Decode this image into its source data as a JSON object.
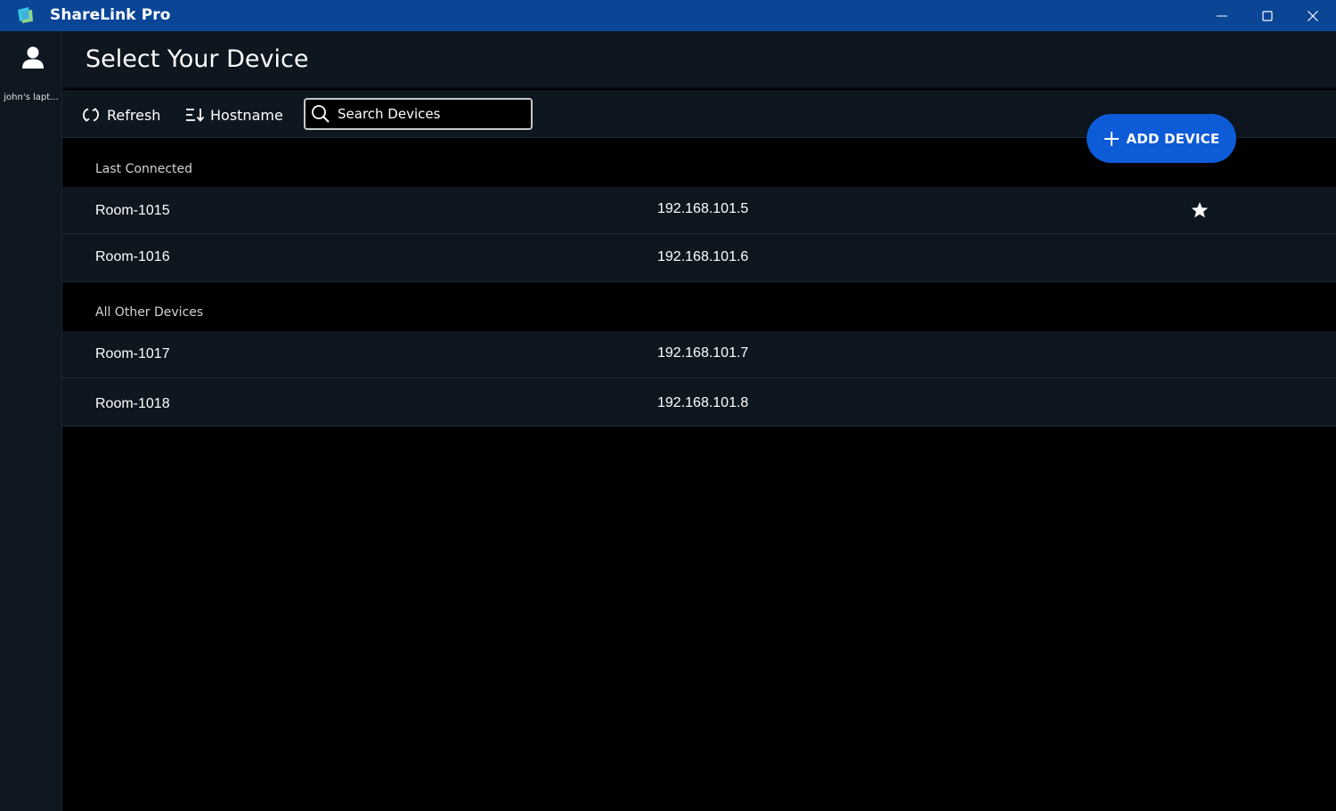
{
  "window": {
    "title": "ShareLink Pro",
    "logo_icon": "app-logo-icon",
    "controls": {
      "minimize_icon": "minimize-icon",
      "maximize_icon": "maximize-icon",
      "close_icon": "close-icon"
    },
    "titlebar_color": "#0a4596"
  },
  "sidebar": {
    "user": {
      "icon": "user-icon",
      "name": "john's lapt..."
    }
  },
  "header": {
    "title": "Select Your Device"
  },
  "toolbar": {
    "refresh": {
      "icon": "refresh-icon",
      "label": "Refresh"
    },
    "sort": {
      "icon": "sort-icon",
      "label": "Hostname"
    },
    "search": {
      "icon": "search-icon",
      "placeholder": "Search Devices",
      "value": ""
    }
  },
  "add_device": {
    "icon": "plus-icon",
    "label": "ADD DEVICE",
    "color": "#0d5bd6"
  },
  "sections": [
    {
      "label": "Last Connected",
      "devices": [
        {
          "name": "Room-1015",
          "ip": "192.168.101.5",
          "favorite": true
        },
        {
          "name": "Room-1016",
          "ip": "192.168.101.6",
          "favorite": false
        }
      ]
    },
    {
      "label": "All Other Devices",
      "devices": [
        {
          "name": "Room-1017",
          "ip": "192.168.101.7",
          "favorite": false
        },
        {
          "name": "Room-1018",
          "ip": "192.168.101.8",
          "favorite": false
        }
      ]
    }
  ]
}
